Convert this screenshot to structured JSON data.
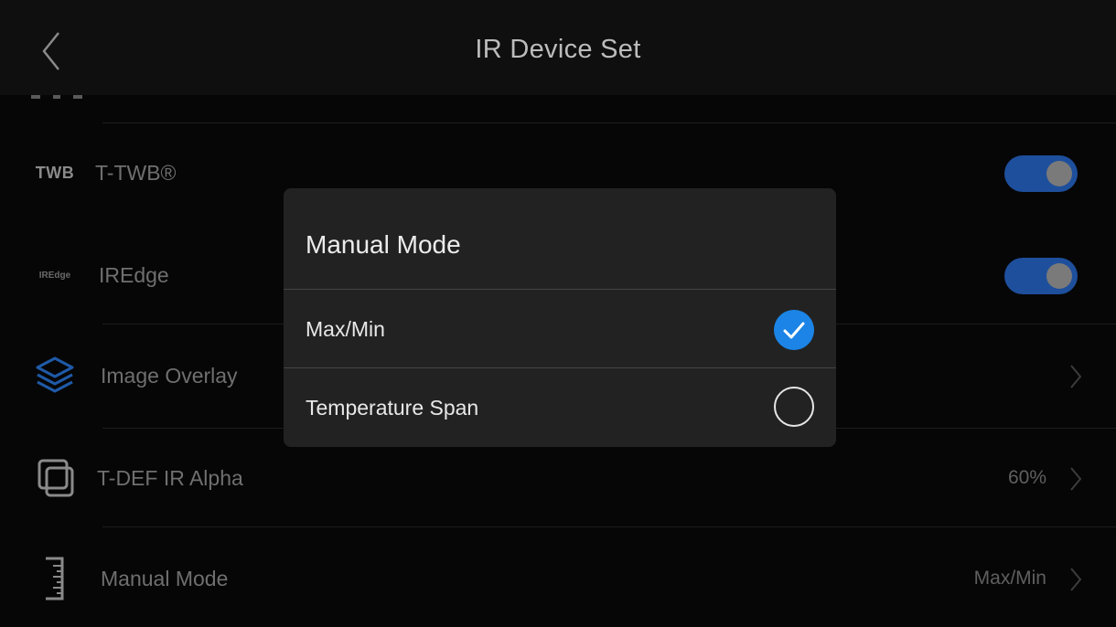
{
  "header": {
    "title": "IR Device Set",
    "back_icon": "chevron-left-icon"
  },
  "settings": {
    "twb": {
      "icon_text": "TWB",
      "label": "T-TWB®",
      "enabled": true
    },
    "iredge": {
      "icon_text": "IREdge",
      "label": "IREdge",
      "enabled": true
    },
    "image_overlay": {
      "icon": "layers-icon",
      "label": "Image Overlay"
    },
    "ir_alpha": {
      "icon": "overlap-squares-icon",
      "label": "T-DEF IR Alpha",
      "value": "60%"
    },
    "manual_mode": {
      "icon": "ruler-icon",
      "label": "Manual Mode",
      "value": "Max/Min"
    }
  },
  "dialog": {
    "title": "Manual Mode",
    "options": [
      {
        "label": "Max/Min",
        "selected": true
      },
      {
        "label": "Temperature Span",
        "selected": false
      }
    ]
  },
  "colors": {
    "accent": "#1b84e6",
    "toggle_on": "#1e4f9c",
    "background": "#060606",
    "dialog_bg": "#222222"
  }
}
